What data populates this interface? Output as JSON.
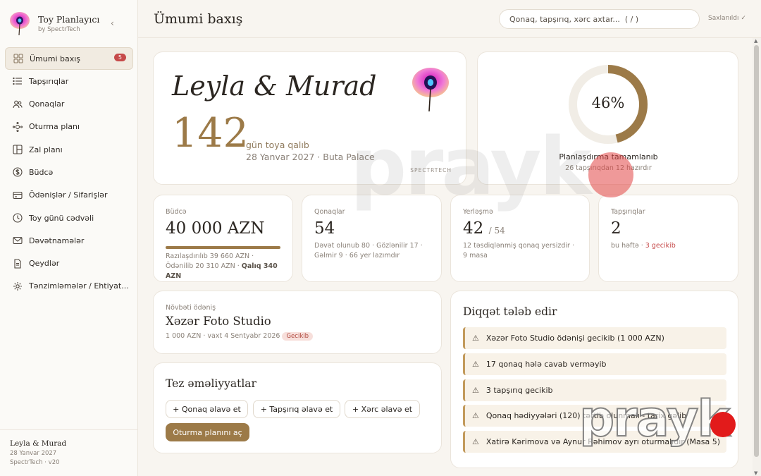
{
  "brand": {
    "name": "Toy Planlayıcı",
    "sub": "by SpectrTech"
  },
  "nav": [
    {
      "label": "Ümumi baxış",
      "icon": "grid-icon",
      "badge": "5",
      "active": true
    },
    {
      "label": "Tapşırıqlar",
      "icon": "list-icon"
    },
    {
      "label": "Qonaqlar",
      "icon": "users-icon"
    },
    {
      "label": "Oturma planı",
      "icon": "seating-icon"
    },
    {
      "label": "Zal planı",
      "icon": "layout-icon"
    },
    {
      "label": "Büdcə",
      "icon": "coin-icon"
    },
    {
      "label": "Ödənişlər / Sifarişlər",
      "icon": "card-icon"
    },
    {
      "label": "Toy günü cədvəli",
      "icon": "clock-icon"
    },
    {
      "label": "Dəvətnamələr",
      "icon": "mail-icon"
    },
    {
      "label": "Qeydlər",
      "icon": "note-icon"
    },
    {
      "label": "Tənzimləmələr / Ehtiyat...",
      "icon": "settings-icon"
    }
  ],
  "sidebar_footer": {
    "couple": "Leyla & Murad",
    "date": "28 Yanvar 2027",
    "version": "SpectrTech · v20"
  },
  "header": {
    "title": "Ümumi baxış",
    "search_placeholder": "Qonaq, tapşırıq, xərc axtar...  ( / )",
    "saved": "Saxlanıldı ✓"
  },
  "hero": {
    "couple": "Leyla & Murad",
    "days": "142",
    "days_label": "gün toya qalıb",
    "date": "28 Yanvar 2027 · Buta Palace",
    "brand": "SPECTRTECH"
  },
  "progress": {
    "percent_text": "46%",
    "fraction": 0.46,
    "title": "Planlaşdırma tamamlanıb",
    "sub": "26 tapşırıqdan 12 hazırdır"
  },
  "stats": {
    "budget": {
      "label": "Büdcə",
      "value": "40 000 AZN",
      "desc": "Razılaşdırılıb 39 660 AZN · Ödənilib 20 310 AZN · ",
      "desc_bold": "Qalıq 340 AZN"
    },
    "guests": {
      "label": "Qonaqlar",
      "value": "54",
      "desc": "Dəvət olunub 80 · Gözlənilir 17 · Gəlmir 9 · 66 yer lazımdır"
    },
    "seating": {
      "label": "Yerləşmə",
      "value": "42",
      "total": "/ 54",
      "desc": "12 təsdiqlənmiş qonaq yersizdir · 9 masa"
    },
    "tasks": {
      "label": "Tapşırıqlar",
      "value": "2",
      "desc": "bu həftə · ",
      "late": "3 gecikib"
    }
  },
  "payment": {
    "label": "Növbəti ödəniş",
    "name": "Xəzər Foto Studio",
    "meta": "1 000 AZN · vaxt 4 Sentyabr 2026",
    "tag": "Gecikib"
  },
  "quick": {
    "title": "Tez əməliyyatlar",
    "add_guest": "+ Qonaq əlavə et",
    "add_task": "+ Tapşırıq əlavə et",
    "add_expense": "+ Xərc əlavə et",
    "open_seating": "Oturma planını aç"
  },
  "attention": {
    "title": "Diqqət tələb edir",
    "items": [
      "Xəzər Foto Studio ödənişi gecikib (1 000 AZN)",
      "17 qonaq hələ cavab verməyib",
      "3 tapşırıq gecikib",
      "Qonaq hədiyyələri (120) tərtib olunmalı - tarix gəlib",
      "Xatirə Kərimova və Aynur Rəhimov ayrı oturmalıdır (Masa 5)"
    ]
  },
  "colors": {
    "accent": "#9c7a48",
    "danger": "#c64a4a",
    "background": "#f8f5f0"
  },
  "watermark": "prayk"
}
